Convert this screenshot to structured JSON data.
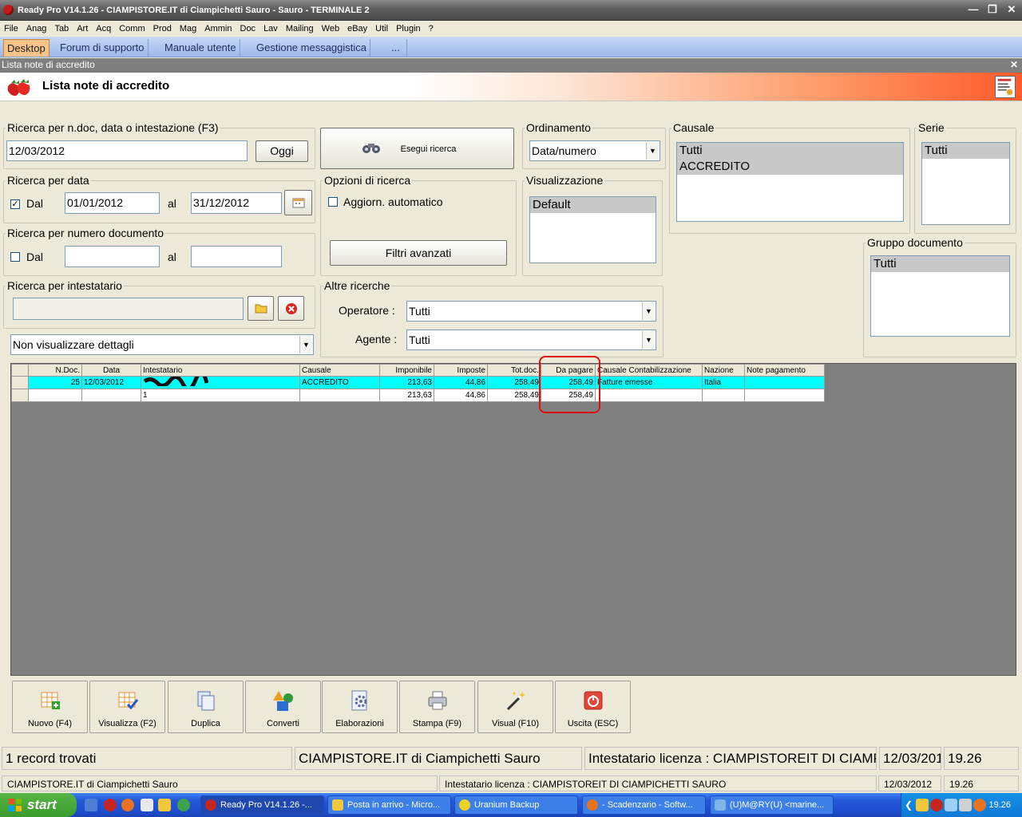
{
  "window": {
    "title": "Ready Pro V14.1.26 - CIAMPISTORE.IT di Ciampichetti Sauro - Sauro - TERMINALE 2"
  },
  "menu": [
    "File",
    "Anag",
    "Tab",
    "Art",
    "Acq",
    "Comm",
    "Prod",
    "Mag",
    "Ammin",
    "Doc",
    "Lav",
    "Mailing",
    "Web",
    "eBay",
    "Util",
    "Plugin",
    "?"
  ],
  "tabs": [
    "Desktop",
    "Forum di supporto",
    "Manuale utente",
    "Gestione messaggistica",
    "..."
  ],
  "subwindow": {
    "caption": "Lista note di accredito",
    "heading": "Lista note di accredito"
  },
  "search": {
    "group_label": "Ricerca per n.doc, data o intestazione (F3)",
    "value": "12/03/2012",
    "today_button": "Oggi",
    "execute_button": "Esegui ricerca"
  },
  "order": {
    "label": "Ordinamento",
    "value": "Data/numero"
  },
  "causale": {
    "label": "Causale",
    "items": [
      "Tutti",
      "ACCREDITO"
    ]
  },
  "serie": {
    "label": "Serie",
    "items": [
      "Tutti"
    ]
  },
  "date_search": {
    "label": "Ricerca per data",
    "from_label": "Dal",
    "from": "01/01/2012",
    "to_label": "al",
    "to": "31/12/2012",
    "checked": true
  },
  "options": {
    "label": "Opzioni di ricerca",
    "auto_update": "Aggiorn. automatico",
    "advanced_filters": "Filtri avanzati"
  },
  "view": {
    "label": "Visualizzazione",
    "items": [
      "Default"
    ]
  },
  "doc_number_search": {
    "label": "Ricerca per numero documento",
    "from_label": "Dal",
    "to_label": "al",
    "checked": false
  },
  "doc_group": {
    "label": "Gruppo documento",
    "items": [
      "Tutti"
    ]
  },
  "holder_search": {
    "label": "Ricerca per intestatario",
    "value": ""
  },
  "other_searches": {
    "label": "Altre ricerche",
    "operator_label": "Operatore :",
    "operator": "Tutti",
    "agent_label": "Agente :",
    "agent": "Tutti"
  },
  "details": {
    "value": "Non visualizzare dettagli"
  },
  "grid": {
    "columns": [
      "N.Doc.",
      "Data",
      "Intestatario",
      "Causale",
      "Imponibile",
      "Imposte",
      "Tot.doc.",
      "Da pagare",
      "Causale Contabilizzazione",
      "Nazione",
      "Note pagamento"
    ],
    "rows": [
      {
        "ndoc": "25",
        "data": "12/03/2012",
        "intestatario": "",
        "causale": "ACCREDITO",
        "imponibile": "213,63",
        "imposte": "44,86",
        "totdoc": "258,49",
        "dapagare": "258,49",
        "causale_cont": "Fatture emesse",
        "nazione": "Italia",
        "note": ""
      },
      {
        "ndoc": "",
        "data": "",
        "intestatario": "1",
        "causale": "",
        "imponibile": "213,63",
        "imposte": "44,86",
        "totdoc": "258,49",
        "dapagare": "258,49",
        "causale_cont": "",
        "nazione": "",
        "note": ""
      }
    ]
  },
  "toolbar": [
    "Nuovo (F4)",
    "Visualizza (F2)",
    "Duplica",
    "Converti",
    "Elaborazioni",
    "Stampa (F9)",
    "Visual (F10)",
    "Uscita (ESC)"
  ],
  "status": {
    "records": "1 record trovati",
    "company": "CIAMPISTORE.IT di Ciampichetti Sauro",
    "license": "Intestatario licenza : CIAMPISTOREIT DI CIAMPICHETTI SAURO",
    "date": "12/03/2012",
    "time": "19.26"
  },
  "taskbar": {
    "start": "start",
    "tasks": [
      "Ready Pro V14.1.26 -...",
      "Posta in arrivo - Micro...",
      "Uranium Backup",
      "- Scadenzario - Softw...",
      "(U)M@RY(U) <marine..."
    ],
    "clock": "19.26"
  },
  "colors": {
    "selected_row": "#00ffff",
    "highlight_circle": "#e01010",
    "tab_active": "#f9c48a"
  }
}
